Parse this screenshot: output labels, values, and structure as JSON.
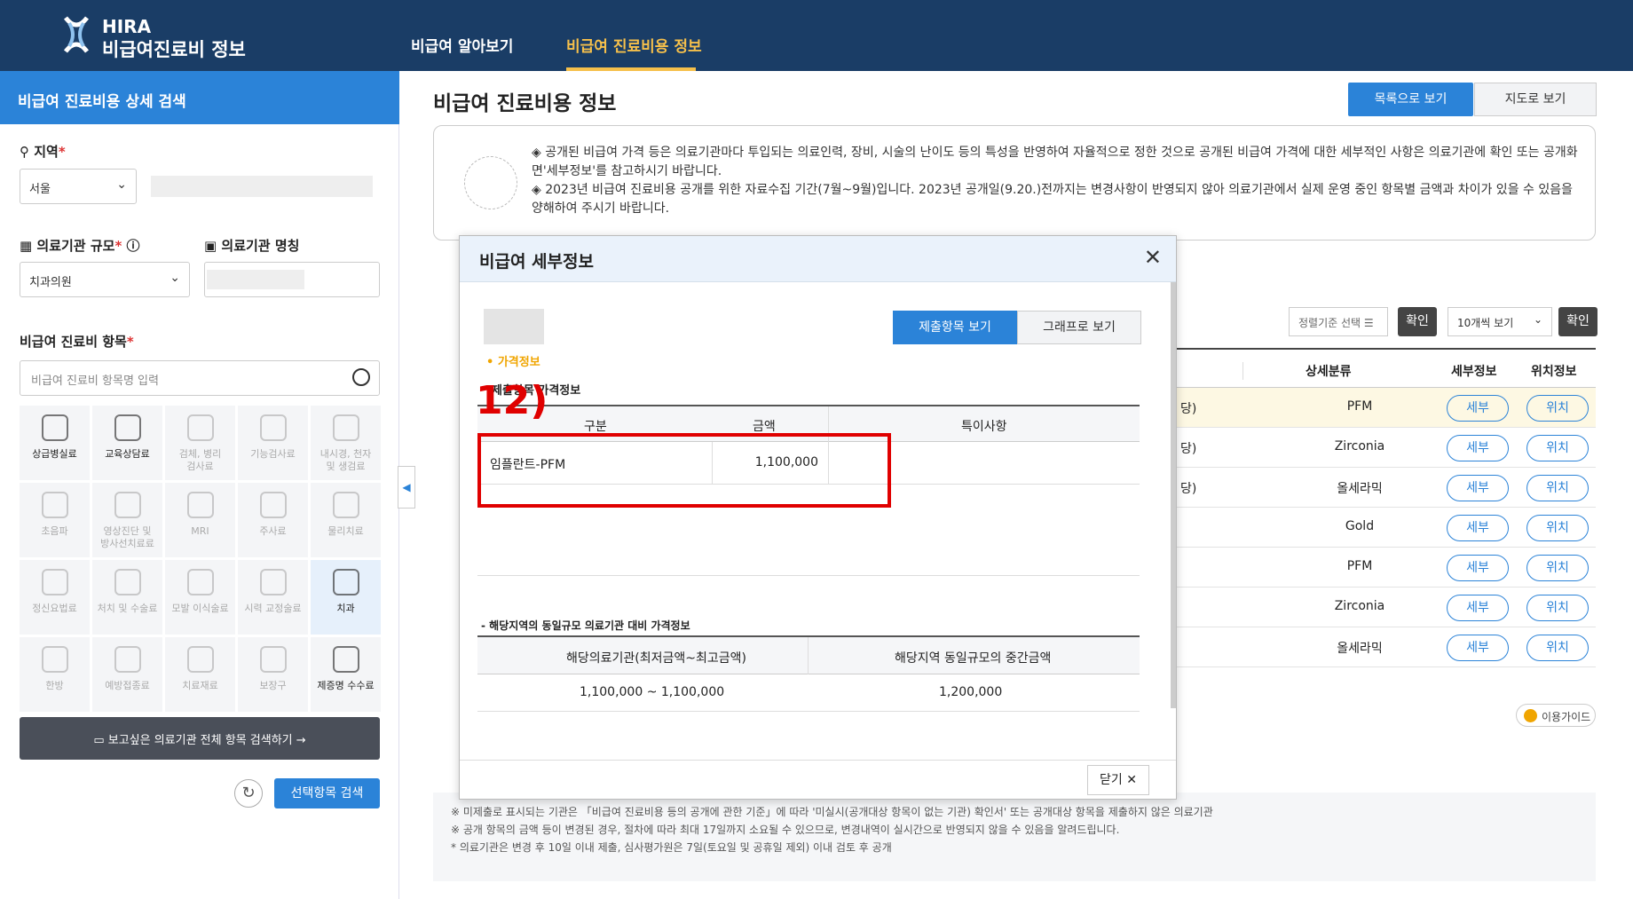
{
  "header": {
    "logo_top": "HIRA",
    "logo_bottom": "비급여진료비 정보",
    "nav": [
      "비급여 알아보기",
      "비급여 진료비용 정보"
    ]
  },
  "sidebar": {
    "title": "비급여 진료비용 상세 검색",
    "region_label": "지역",
    "region_value": "서울",
    "scale_label": "의료기관 규모",
    "scale_value": "치과의원",
    "name_label": "의료기관 명칭",
    "items_label": "비급여 진료비 항목",
    "items_placeholder": "비급여 진료비 항목명 입력",
    "categories": [
      "상급병실료",
      "교육상담료",
      "검체, 병리\n검사료",
      "기능검사료",
      "내시경, 천자\n및 생검료",
      "초음파",
      "영상진단 및\n방사선치료료",
      "MRI",
      "주사료",
      "물리치료",
      "정신요법료",
      "처치 및 수술료",
      "모발 이식술료",
      "시력 교정술료",
      "치과",
      "한방",
      "예방접종료",
      "치료재료",
      "보장구",
      "제증명 수수료"
    ],
    "all_search": "보고싶은 의료기관 전체 항목 검색하기",
    "search_btn": "선택항목 검색"
  },
  "main": {
    "title": "비급여 진료비용 정보",
    "view_list": "목록으로 보기",
    "view_map": "지도로 보기",
    "notice1": "◈ 공개된 비급여 가격 등은 의료기관마다 투입되는 의료인력, 장비, 시술의 난이도 등의 특성을 반영하여 자율적으로 정한 것으로 공개된 비급여 가격에 대한 세부적인 사항은 의료기관에 확인 또는 공개화면'세부정보'를 참고하시기 바랍니다.",
    "notice2": "◈ 2023년 비급여 진료비용 공개를 위한 자료수집 기간(7월~9월)입니다. 2023년 공개일(9.20.)전까지는 변경사항이 반영되지 않아 의료기관에서 실제 운영 중인 항목별 금액과 차이가 있을 수 있음을 양해하여 주시기 바랍니다.",
    "sort_label": "정렬기준 선택",
    "confirm": "확인",
    "per_page": "10개씩 보기",
    "columns": [
      "상세분류",
      "세부정보",
      "위치정보"
    ],
    "rows": [
      {
        "tail": "당)",
        "detail": "PFM"
      },
      {
        "tail": "당)",
        "detail": "Zirconia"
      },
      {
        "tail": "당)",
        "detail": "올세라믹"
      },
      {
        "tail": "",
        "detail": "Gold"
      },
      {
        "tail": "",
        "detail": "PFM"
      },
      {
        "tail": "",
        "detail": "Zirconia"
      },
      {
        "tail": "",
        "detail": "올세라믹"
      }
    ],
    "row_btn_detail": "세부",
    "row_btn_loc": "위치",
    "guide": "이용가이드",
    "notes": [
      "※ 미제출로 표시되는 기관은 「비급여 진료비용 등의 공개에 관한 기준」에 따라 '미실시(공개대상 항목이 없는 기관) 확인서' 또는 공개대상 항목을 제출하지 않은 의료기관",
      "※ 공개 항목의 금액 등이 변경된 경우, 절차에 따라 최대 17일까지 소요될 수 있으므로, 변경내역이 실시간으로 반영되지 않을 수 있음을 알려드립니다.",
      "* 의료기관은 변경 후 10일 이내 제출, 심사평가원은 7일(토요일 및 공휴일 제외) 이내 검토 후 공개"
    ]
  },
  "modal": {
    "title": "비급여 세부정보",
    "tab_submitted": "제출항목 보기",
    "tab_graph": "그래프로 보기",
    "price_info": "• 가격정보",
    "submitted_prices": "제출항목 가격정보",
    "annotation": "12)",
    "t1_cols": [
      "구분",
      "금액",
      "특이사항"
    ],
    "t1_row": {
      "item": "임플란트-PFM",
      "amount": "1,100,000",
      "note": ""
    },
    "compare_title": "- 해당지역의 동일규모 의료기관 대비 가격정보",
    "t2_cols": [
      "해당의료기관(최저금액~최고금액)",
      "해당지역 동일규모의 중간금액"
    ],
    "t2_row": {
      "range": "1,100,000 ~ 1,100,000",
      "median": "1,200,000"
    },
    "close": "닫기"
  }
}
